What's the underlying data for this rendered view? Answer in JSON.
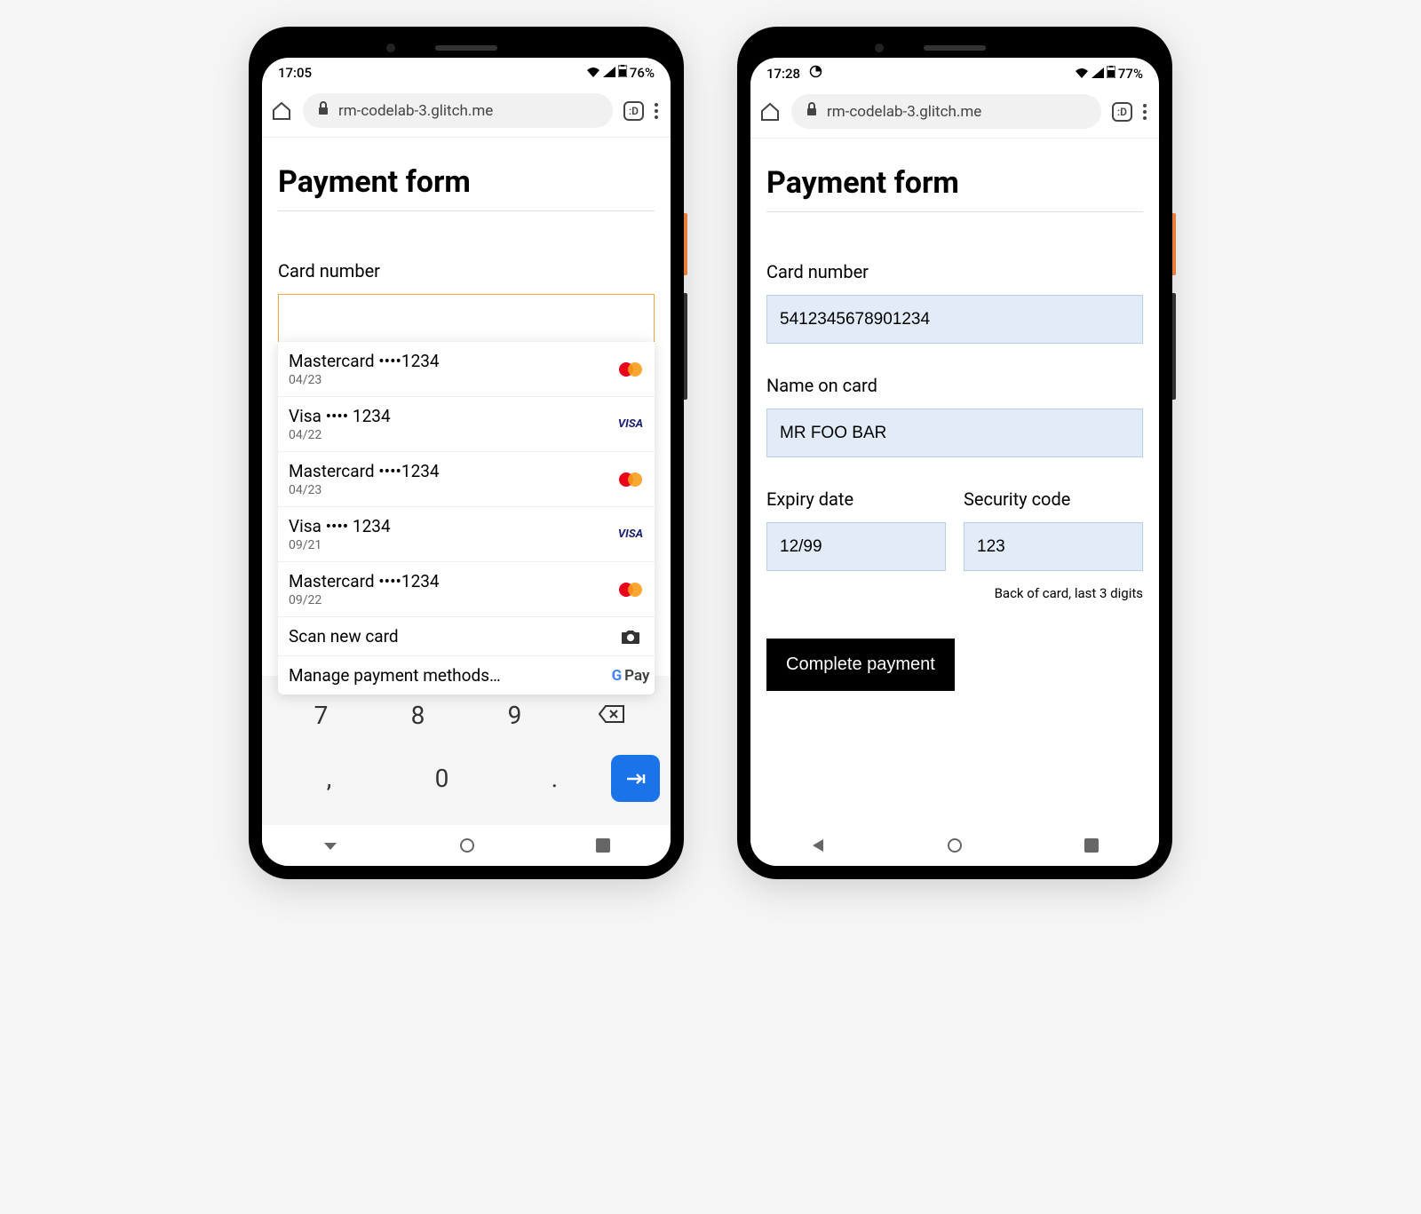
{
  "phones": {
    "left": {
      "status": {
        "time": "17:05",
        "battery": "76%",
        "battery_prefix": "▾◢ ⬛"
      },
      "url": "rm-codelab-3.glitch.me",
      "title": "Payment form",
      "card_number_label": "Card number",
      "card_number_value": "",
      "autofill": {
        "items": [
          {
            "title": "Mastercard  ••••1234",
            "sub": "04/23",
            "brand": "mc"
          },
          {
            "title": "Visa  •••• 1234",
            "sub": "04/22",
            "brand": "visa"
          },
          {
            "title": "Mastercard  ••••1234",
            "sub": "04/23",
            "brand": "mc"
          },
          {
            "title": "Visa  •••• 1234",
            "sub": "09/21",
            "brand": "visa"
          },
          {
            "title": "Mastercard  ••••1234",
            "sub": "09/22",
            "brand": "mc"
          }
        ],
        "scan_label": "Scan new card",
        "manage_label": "Manage payment methods…"
      },
      "keypad": {
        "row1": [
          "7",
          "8",
          "9",
          "⌫"
        ],
        "row2": [
          ",",
          "0",
          ".",
          "→|"
        ]
      }
    },
    "right": {
      "status": {
        "time": "17:28",
        "battery": "77%"
      },
      "url": "rm-codelab-3.glitch.me",
      "title": "Payment form",
      "card_number_label": "Card number",
      "card_number_value": "5412345678901234",
      "name_label": "Name on card",
      "name_value": "MR FOO BAR",
      "expiry_label": "Expiry date",
      "expiry_value": "12/99",
      "cvc_label": "Security code",
      "cvc_value": "123",
      "hint": "Back of card, last 3 digits",
      "submit_label": "Complete payment"
    }
  },
  "tab_count": ":D"
}
